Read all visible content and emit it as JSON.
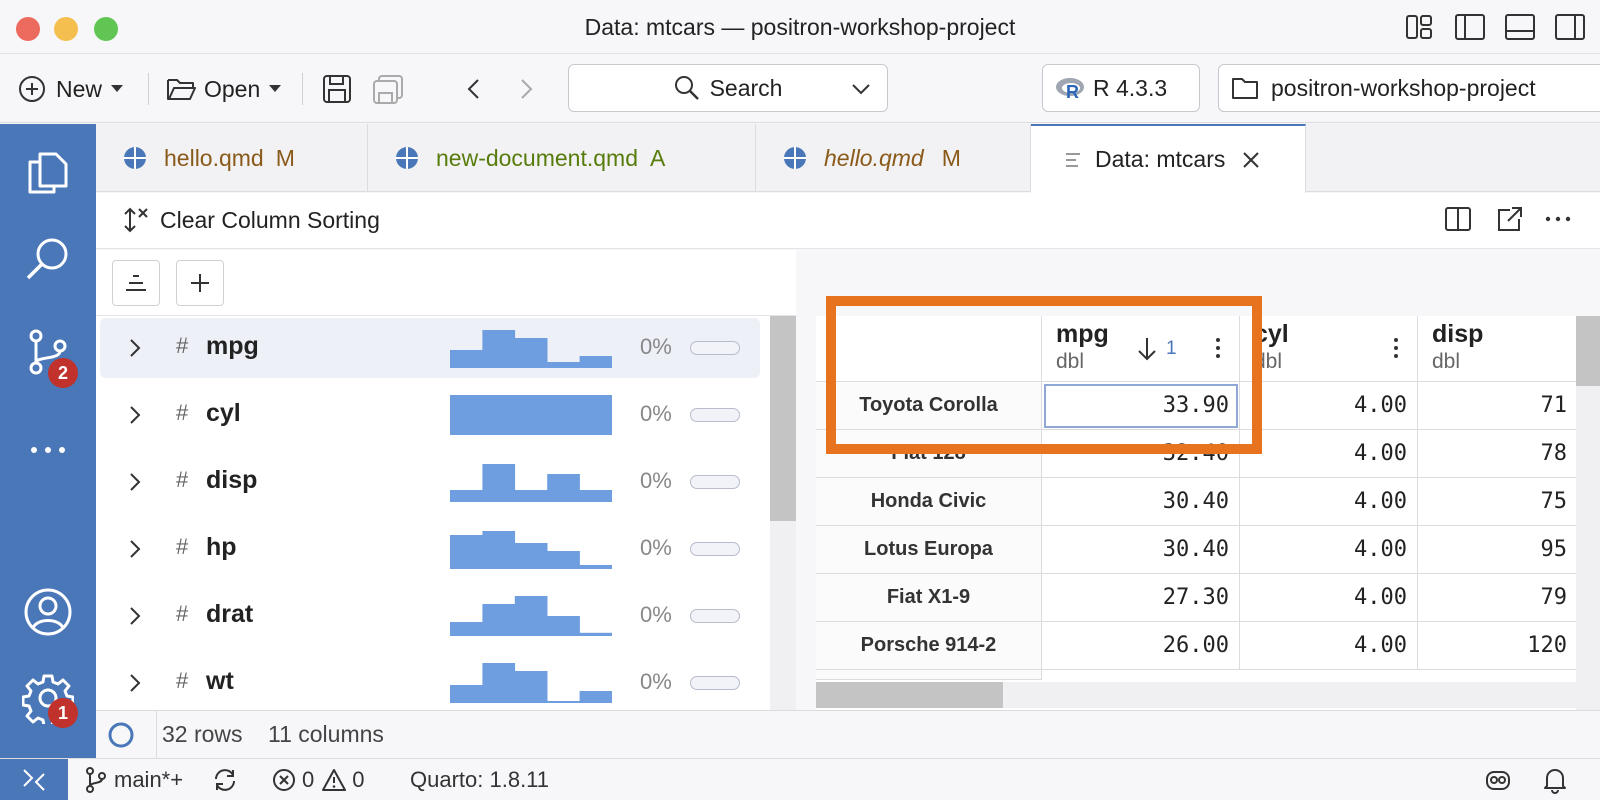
{
  "window": {
    "title": "Data: mtcars — positron-workshop-project",
    "colors": {
      "close": "#ed6a5e",
      "minimize": "#f5bf4f",
      "maximize": "#61c554",
      "accent": "#4a77b8",
      "highlight": "#e8731e"
    }
  },
  "toolbar": {
    "new_label": "New",
    "open_label": "Open",
    "search_label": "Search",
    "r_version": "R 4.3.3",
    "project_name": "positron-workshop-project"
  },
  "activity": {
    "scm_badge": "2",
    "settings_badge": "1"
  },
  "tabs": [
    {
      "label": "hello.qmd",
      "status": "M",
      "color": "#8a5a1a",
      "italic": false
    },
    {
      "label": "new-document.qmd",
      "status": "A",
      "color": "#587c0c",
      "italic": false
    },
    {
      "label": "hello.qmd",
      "status": "M",
      "color": "#8a5a1a",
      "italic": true
    },
    {
      "label": "Data: mtcars",
      "status": "",
      "color": "#222222",
      "italic": false
    }
  ],
  "subbar": {
    "clear_sorting_label": "Clear Column Sorting"
  },
  "summary": {
    "columns": [
      {
        "name": "mpg",
        "missing": "0%",
        "hist": [
          0.45,
          0.95,
          0.75,
          0.15,
          0.3
        ]
      },
      {
        "name": "cyl",
        "missing": "0%",
        "hist": [
          1.0,
          1.0,
          1.0
        ]
      },
      {
        "name": "disp",
        "missing": "0%",
        "hist": [
          0.3,
          0.95,
          0.3,
          0.7,
          0.3
        ]
      },
      {
        "name": "hp",
        "missing": "0%",
        "hist": [
          0.85,
          0.95,
          0.65,
          0.45,
          0.1
        ]
      },
      {
        "name": "drat",
        "missing": "0%",
        "hist": [
          0.35,
          0.8,
          1.0,
          0.5,
          0.08
        ]
      },
      {
        "name": "wt",
        "missing": "0%",
        "hist": [
          0.45,
          1.0,
          0.8,
          0.05,
          0.3
        ]
      }
    ]
  },
  "grid": {
    "columns": [
      {
        "name": "mpg",
        "type": "dbl",
        "sort_rank": "1"
      },
      {
        "name": "cyl",
        "type": "dbl"
      },
      {
        "name": "disp",
        "type": "dbl"
      }
    ],
    "rows": [
      {
        "label": "Toyota Corolla",
        "mpg": "33.90",
        "cyl": "4.00",
        "disp": "71"
      },
      {
        "label": "Fiat 128",
        "mpg": "32.40",
        "cyl": "4.00",
        "disp": "78"
      },
      {
        "label": "Honda Civic",
        "mpg": "30.40",
        "cyl": "4.00",
        "disp": "75"
      },
      {
        "label": "Lotus Europa",
        "mpg": "30.40",
        "cyl": "4.00",
        "disp": "95"
      },
      {
        "label": "Fiat X1-9",
        "mpg": "27.30",
        "cyl": "4.00",
        "disp": "79"
      },
      {
        "label": "Porsche 914-2",
        "mpg": "26.00",
        "cyl": "4.00",
        "disp": "120"
      }
    ]
  },
  "footer": {
    "rows": "32 rows",
    "columns": "11 columns"
  },
  "statusbar": {
    "branch": "main*+",
    "errors": "0",
    "warnings": "0",
    "quarto": "Quarto: 1.8.11"
  }
}
